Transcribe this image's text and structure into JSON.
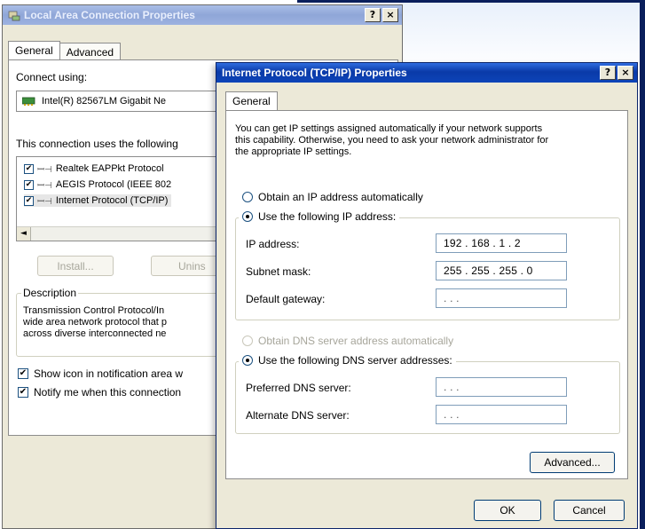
{
  "back_window": {
    "title": "Local Area Connection Properties",
    "help_btn": "?",
    "close_btn": "×",
    "tabs": [
      {
        "label": "General"
      },
      {
        "label": "Advanced"
      }
    ],
    "connect_using_label": "Connect using:",
    "adapter_name": "Intel(R) 82567LM Gigabit Ne",
    "items_label": "This connection uses the following",
    "items": [
      {
        "checked": "✔",
        "icon": "ꟷ⊣",
        "label": "Realtek EAPPkt Protocol"
      },
      {
        "checked": "✔",
        "icon": "ꟷ⊣",
        "label": "AEGIS Protocol (IEEE 802"
      },
      {
        "checked": "✔",
        "icon": "ꟷ⊣",
        "label": "Internet Protocol (TCP/IP)"
      }
    ],
    "scroll_left": "◄",
    "install_btn": "Install...",
    "uninstall_btn": "Unins",
    "description_label": "Description",
    "description_lines": [
      "Transmission Control Protocol/In",
      "wide area network protocol that p",
      "across diverse interconnected ne"
    ],
    "show_icon_check": {
      "checked": "✔",
      "label": "Show icon in notification area w"
    },
    "notify_check": {
      "checked": "✔",
      "label": "Notify me when this connection"
    }
  },
  "front_window": {
    "title": "Internet Protocol (TCP/IP) Properties",
    "help_btn": "?",
    "close_btn": "×",
    "tab": "General",
    "intro_lines": [
      "You can get IP settings assigned automatically if your network supports",
      "this capability. Otherwise, you need to ask your network administrator for",
      "the appropriate IP settings."
    ],
    "obtain_ip_auto": "Obtain an IP address automatically",
    "use_following_ip": "Use the following IP address:",
    "ip_address_label": "IP address:",
    "ip_address": "192 . 168 .  1  .  2",
    "subnet_label": "Subnet mask:",
    "subnet": "255 . 255 . 255 .  0",
    "gateway_label": "Default gateway:",
    "gateway": "     .       .       .",
    "obtain_dns_auto": "Obtain DNS server address automatically",
    "use_following_dns": "Use the following DNS server addresses:",
    "preferred_dns_label": "Preferred DNS server:",
    "preferred_dns": "     .       .       .",
    "alternate_dns_label": "Alternate DNS server:",
    "alternate_dns": "     .       .       .",
    "advanced_btn": "Advanced...",
    "ok_btn": "OK",
    "cancel_btn": "Cancel"
  },
  "colors": {
    "active_title": "#0a3aa8",
    "inactive_title": "#8fa6d8",
    "dialog_bg": "#ece9d8",
    "frame": "#0a1f5c"
  }
}
